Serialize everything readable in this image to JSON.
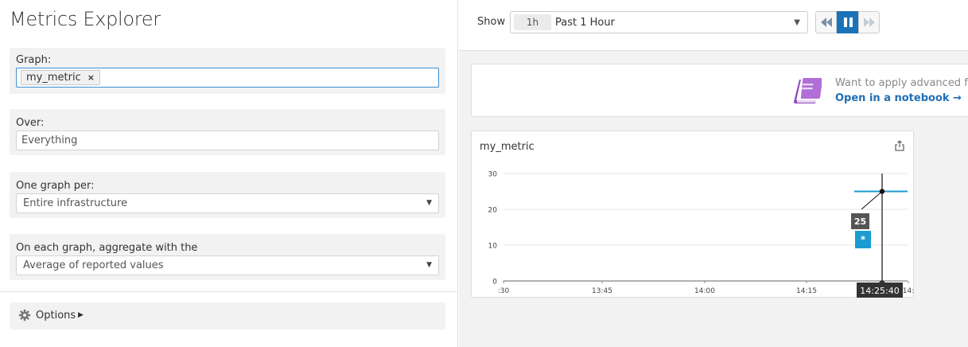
{
  "page": {
    "title": "Metrics Explorer"
  },
  "form": {
    "graph": {
      "label": "Graph:",
      "tag": "my_metric",
      "remove": "×"
    },
    "over": {
      "label": "Over:",
      "value": "Everything"
    },
    "one_graph_per": {
      "label": "One graph per:",
      "value": "Entire infrastructure"
    },
    "aggregate": {
      "label": "On each graph, aggregate with the",
      "value": "Average of reported values"
    },
    "options": {
      "label": "Options"
    }
  },
  "toolbar": {
    "show_label": "Show",
    "range_short": "1h",
    "range_label": "Past 1 Hour"
  },
  "banner": {
    "text": "Want to apply advanced fur",
    "link": "Open in a notebook →"
  },
  "graph": {
    "title": "my_metric"
  },
  "colors": {
    "accent": "#1a73b8",
    "series": "#1b9bd0",
    "notebook": "#b06ed6",
    "link": "#1f6fb5"
  },
  "chart_data": {
    "type": "line",
    "title": "my_metric",
    "xlabel": "",
    "ylabel": "",
    "ylim": [
      0,
      30
    ],
    "yticks": [
      "0",
      "10",
      "20",
      "30"
    ],
    "xticks": [
      ":30",
      "13:45",
      "14:00",
      "14:15",
      "14:"
    ],
    "series": [
      {
        "values": [
          25,
          25
        ]
      }
    ],
    "hover": {
      "time": "14:25:40",
      "value": "25",
      "series_marker": "*"
    },
    "grid": true
  }
}
